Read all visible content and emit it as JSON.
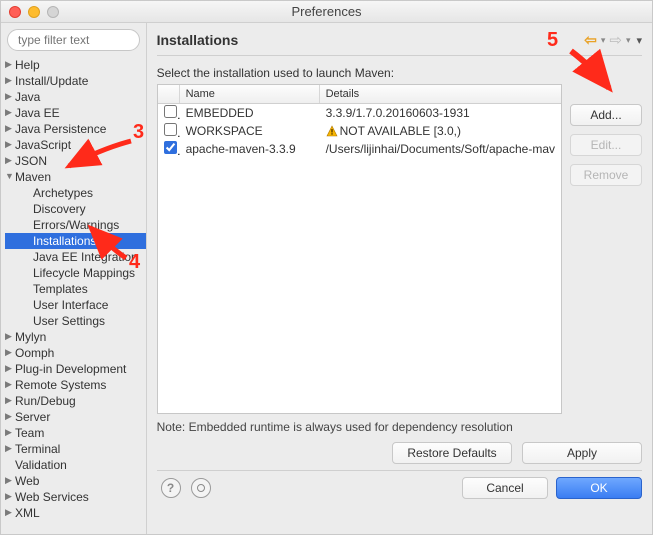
{
  "window": {
    "title": "Preferences"
  },
  "filter": {
    "placeholder": "type filter text"
  },
  "tree": {
    "items": [
      {
        "label": "Help",
        "expandable": true,
        "expanded": false,
        "level": 0
      },
      {
        "label": "Install/Update",
        "expandable": true,
        "expanded": false,
        "level": 0
      },
      {
        "label": "Java",
        "expandable": true,
        "expanded": false,
        "level": 0
      },
      {
        "label": "Java EE",
        "expandable": true,
        "expanded": false,
        "level": 0
      },
      {
        "label": "Java Persistence",
        "expandable": true,
        "expanded": false,
        "level": 0
      },
      {
        "label": "JavaScript",
        "expandable": true,
        "expanded": false,
        "level": 0
      },
      {
        "label": "JSON",
        "expandable": true,
        "expanded": false,
        "level": 0
      },
      {
        "label": "Maven",
        "expandable": true,
        "expanded": true,
        "level": 0
      },
      {
        "label": "Archetypes",
        "expandable": false,
        "level": 1
      },
      {
        "label": "Discovery",
        "expandable": false,
        "level": 1
      },
      {
        "label": "Errors/Warnings",
        "expandable": false,
        "level": 1
      },
      {
        "label": "Installations",
        "expandable": false,
        "level": 1,
        "selected": true
      },
      {
        "label": "Java EE Integration",
        "expandable": false,
        "level": 1
      },
      {
        "label": "Lifecycle Mappings",
        "expandable": false,
        "level": 1
      },
      {
        "label": "Templates",
        "expandable": false,
        "level": 1
      },
      {
        "label": "User Interface",
        "expandable": false,
        "level": 1
      },
      {
        "label": "User Settings",
        "expandable": false,
        "level": 1
      },
      {
        "label": "Mylyn",
        "expandable": true,
        "expanded": false,
        "level": 0
      },
      {
        "label": "Oomph",
        "expandable": true,
        "expanded": false,
        "level": 0
      },
      {
        "label": "Plug-in Development",
        "expandable": true,
        "expanded": false,
        "level": 0
      },
      {
        "label": "Remote Systems",
        "expandable": true,
        "expanded": false,
        "level": 0
      },
      {
        "label": "Run/Debug",
        "expandable": true,
        "expanded": false,
        "level": 0
      },
      {
        "label": "Server",
        "expandable": true,
        "expanded": false,
        "level": 0
      },
      {
        "label": "Team",
        "expandable": true,
        "expanded": false,
        "level": 0
      },
      {
        "label": "Terminal",
        "expandable": true,
        "expanded": false,
        "level": 0
      },
      {
        "label": "Validation",
        "expandable": false,
        "level": 0
      },
      {
        "label": "Web",
        "expandable": true,
        "expanded": false,
        "level": 0
      },
      {
        "label": "Web Services",
        "expandable": true,
        "expanded": false,
        "level": 0
      },
      {
        "label": "XML",
        "expandable": true,
        "expanded": false,
        "level": 0
      }
    ]
  },
  "page": {
    "heading": "Installations",
    "description": "Select the installation used to launch Maven:",
    "note": "Note: Embedded runtime is always used for dependency resolution",
    "columns": {
      "name": "Name",
      "details": "Details"
    },
    "rows": [
      {
        "checked": false,
        "name": "EMBEDDED",
        "details": "3.3.9/1.7.0.20160603-1931",
        "warn": false
      },
      {
        "checked": false,
        "name": "WORKSPACE",
        "details": "NOT AVAILABLE [3.0,)",
        "warn": true
      },
      {
        "checked": true,
        "name": "apache-maven-3.3.9",
        "details": "/Users/lijinhai/Documents/Soft/apache-mav",
        "warn": false
      }
    ],
    "buttons": {
      "add": "Add...",
      "edit": "Edit...",
      "remove": "Remove",
      "restore": "Restore Defaults",
      "apply": "Apply",
      "cancel": "Cancel",
      "ok": "OK"
    }
  },
  "annotations": {
    "n3": "3",
    "n4": "4",
    "n5": "5"
  }
}
